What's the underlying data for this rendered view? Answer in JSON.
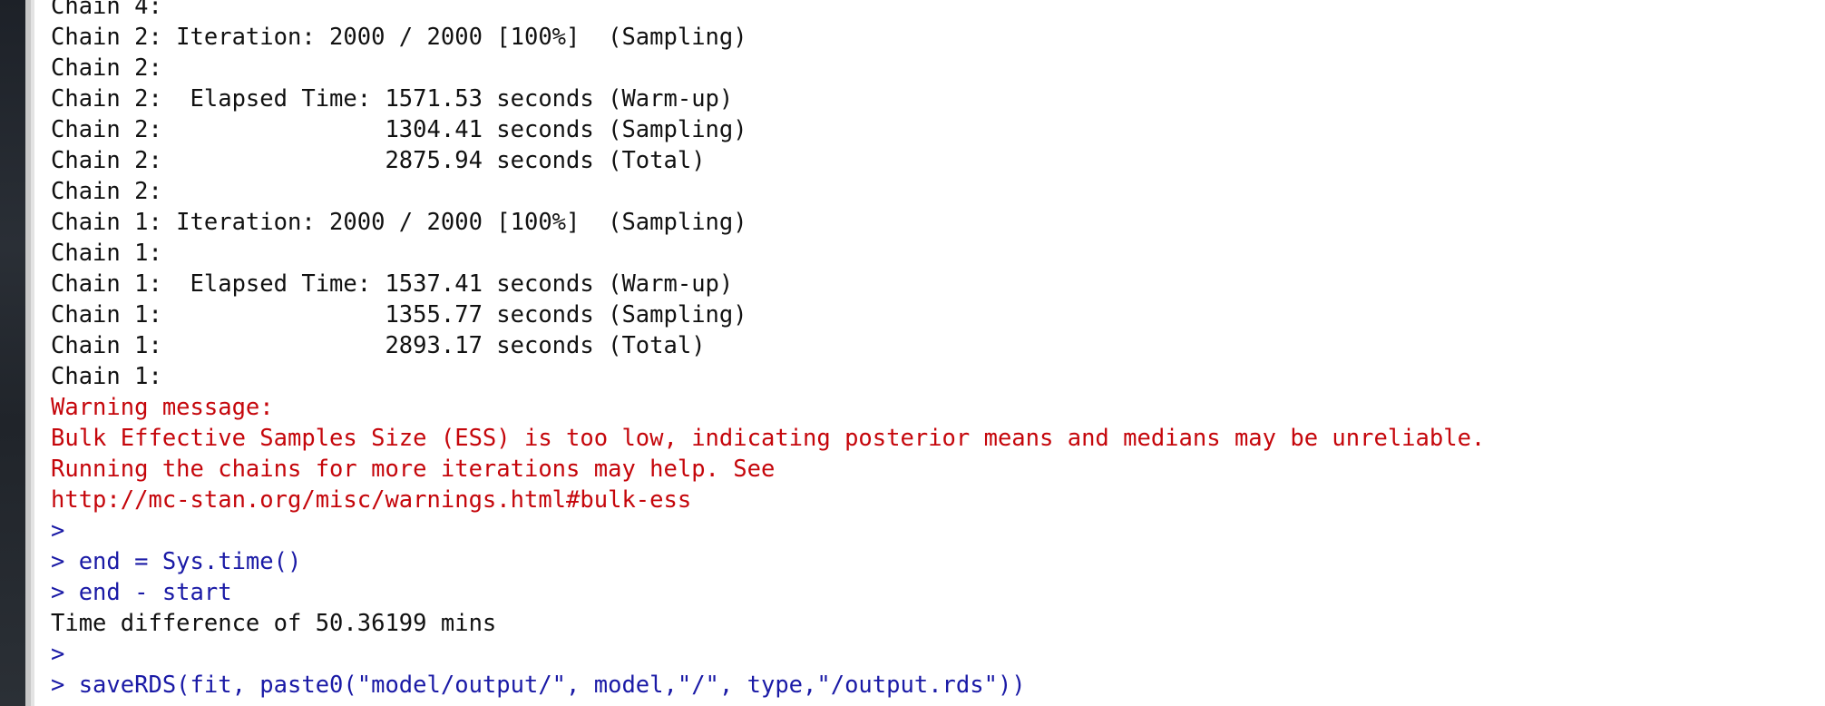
{
  "console": {
    "lines": [
      {
        "text": "Chain 4:",
        "kind": "output"
      },
      {
        "text": "Chain 2: Iteration: 2000 / 2000 [100%]  (Sampling)",
        "kind": "output"
      },
      {
        "text": "Chain 2:",
        "kind": "output"
      },
      {
        "text": "Chain 2:  Elapsed Time: 1571.53 seconds (Warm-up)",
        "kind": "output"
      },
      {
        "text": "Chain 2:                1304.41 seconds (Sampling)",
        "kind": "output"
      },
      {
        "text": "Chain 2:                2875.94 seconds (Total)",
        "kind": "output"
      },
      {
        "text": "Chain 2:",
        "kind": "output"
      },
      {
        "text": "Chain 1: Iteration: 2000 / 2000 [100%]  (Sampling)",
        "kind": "output"
      },
      {
        "text": "Chain 1:",
        "kind": "output"
      },
      {
        "text": "Chain 1:  Elapsed Time: 1537.41 seconds (Warm-up)",
        "kind": "output"
      },
      {
        "text": "Chain 1:                1355.77 seconds (Sampling)",
        "kind": "output"
      },
      {
        "text": "Chain 1:                2893.17 seconds (Total)",
        "kind": "output"
      },
      {
        "text": "Chain 1:",
        "kind": "output"
      },
      {
        "text": "Warning message:",
        "kind": "warning"
      },
      {
        "text": "Bulk Effective Samples Size (ESS) is too low, indicating posterior means and medians may be unreliable.",
        "kind": "warning"
      },
      {
        "text": "Running the chains for more iterations may help. See",
        "kind": "warning"
      },
      {
        "text": "http://mc-stan.org/misc/warnings.html#bulk-ess",
        "kind": "warning"
      },
      {
        "text": ">",
        "kind": "command"
      },
      {
        "text": "> end = Sys.time()",
        "kind": "command"
      },
      {
        "text": "> end - start",
        "kind": "command"
      },
      {
        "text": "Time difference of 50.36199 mins",
        "kind": "output"
      },
      {
        "text": ">",
        "kind": "command"
      },
      {
        "text": "> saveRDS(fit, paste0(\"model/output/\", model,\"/\", type,\"/output.rds\"))",
        "kind": "command"
      }
    ]
  },
  "colors": {
    "output": "#111111",
    "warning": "#c5060b",
    "command": "#1a1aa6",
    "background": "#ffffff"
  }
}
